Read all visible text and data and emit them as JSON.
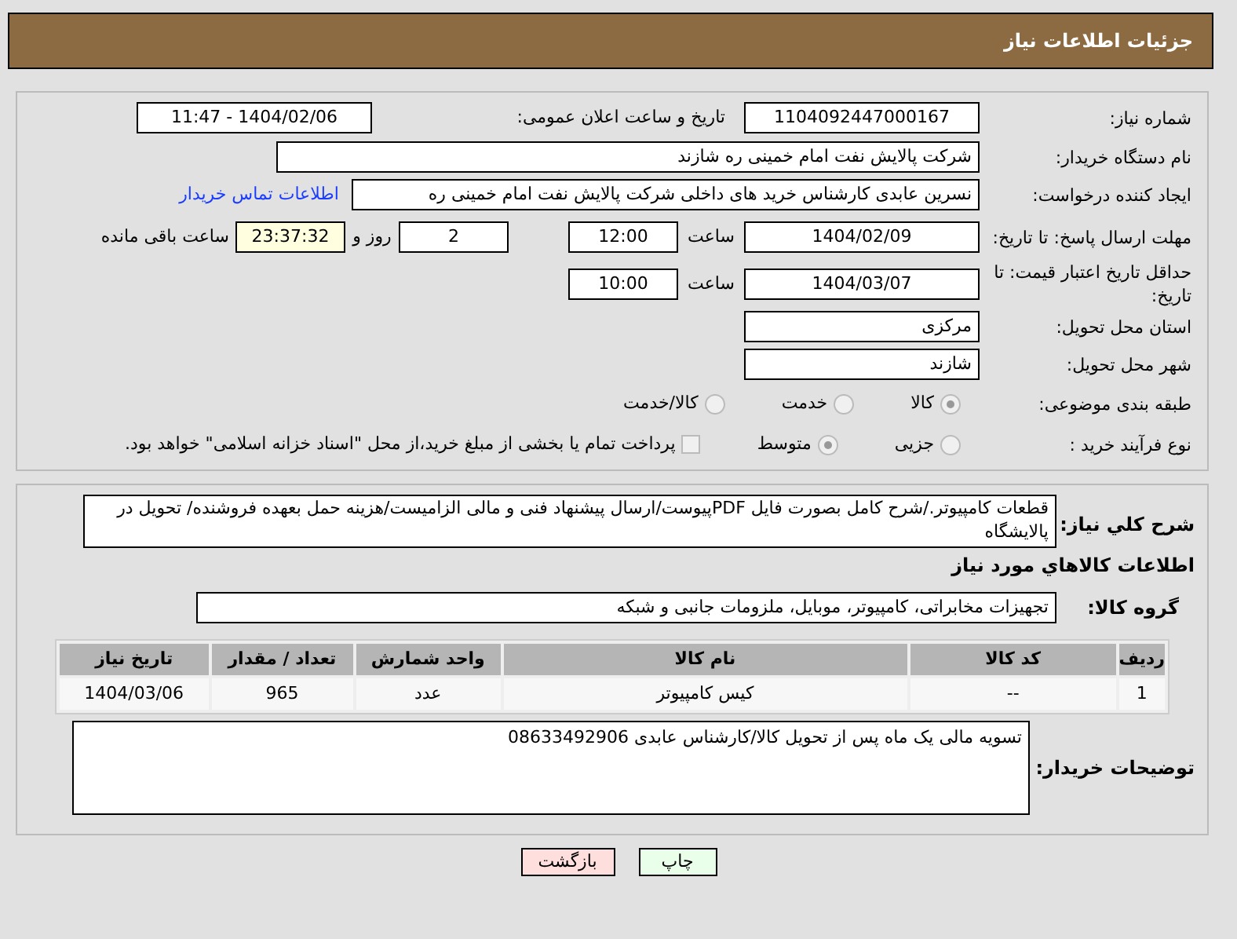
{
  "header": {
    "title": "جزئیات اطلاعات نیاز"
  },
  "details": {
    "need_number": {
      "label": "شماره نیاز:",
      "value": "1104092447000167"
    },
    "announce": {
      "label": "تاریخ و ساعت اعلان عمومی:",
      "value": "1404/02/06 - 11:47"
    },
    "buyer": {
      "label": "نام دستگاه خریدار:",
      "value": "شرکت پالایش نفت امام خمینی  ره  شازند"
    },
    "creator": {
      "label": "ایجاد کننده درخواست:",
      "value": "نسرین عابدی کارشناس خرید های داخلی  شرکت پالایش نفت امام خمینی  ره",
      "link": "اطلاعات تماس خریدار"
    },
    "deadline": {
      "label": "مهلت ارسال پاسخ: تا تاریخ:",
      "date": "1404/02/09",
      "time_label": "ساعت",
      "time": "12:00",
      "days": "2",
      "days_label": "روز و",
      "remaining": "23:37:32",
      "remaining_label": "ساعت باقی مانده"
    },
    "validity": {
      "label": "حداقل تاریخ اعتبار قیمت: تا تاریخ:",
      "date": "1404/03/07",
      "time_label": "ساعت",
      "time": "10:00"
    },
    "province": {
      "label": "استان محل تحویل:",
      "value": "مرکزی"
    },
    "city": {
      "label": "شهر محل تحویل:",
      "value": "شازند"
    },
    "category": {
      "label": "طبقه بندی موضوعی:",
      "options": [
        {
          "label": "کالا",
          "selected": true
        },
        {
          "label": "خدمت",
          "selected": false
        },
        {
          "label": "کالا/خدمت",
          "selected": false
        }
      ]
    },
    "process": {
      "label": "نوع فرآیند خرید :",
      "options": [
        {
          "label": "جزیی",
          "selected": false
        },
        {
          "label": "متوسط",
          "selected": true
        }
      ],
      "payment": {
        "checked": false,
        "text": "پرداخت تمام یا بخشی از مبلغ خرید،از محل \"اسناد خزانه اسلامی\" خواهد بود."
      }
    }
  },
  "goods": {
    "description": {
      "label": "شرح کلي نياز:",
      "value": "قطعات کامپیوتر./شرح کامل بصورت فایل PDFپیوست/ارسال پیشنهاد فنی و مالی الزامیست/هزینه حمل بعهده فروشنده/ تحویل در پالایشگاه"
    },
    "heading": "اطلاعات کالاهاي مورد نياز",
    "group": {
      "label": "گروه کالا:",
      "value": "تجهیزات مخابراتی، کامپیوتر، موبایل، ملزومات جانبی و شبکه"
    },
    "table": {
      "columns": [
        "ردیف",
        "کد کالا",
        "نام کالا",
        "واحد شمارش",
        "تعداد / مقدار",
        "تاریخ نیاز"
      ],
      "rows": [
        [
          "1",
          "--",
          "کیس کامپیوتر",
          "عدد",
          "965",
          "1404/03/06"
        ]
      ]
    },
    "notes": {
      "label": "توضیحات خریدار:",
      "value": "تسویه مالی یک ماه پس از تحویل کالا/کارشناس عابدی 08633492906"
    }
  },
  "buttons": [
    {
      "label": "چاپ",
      "kind": "print"
    },
    {
      "label": "بازگشت",
      "kind": "back"
    }
  ]
}
